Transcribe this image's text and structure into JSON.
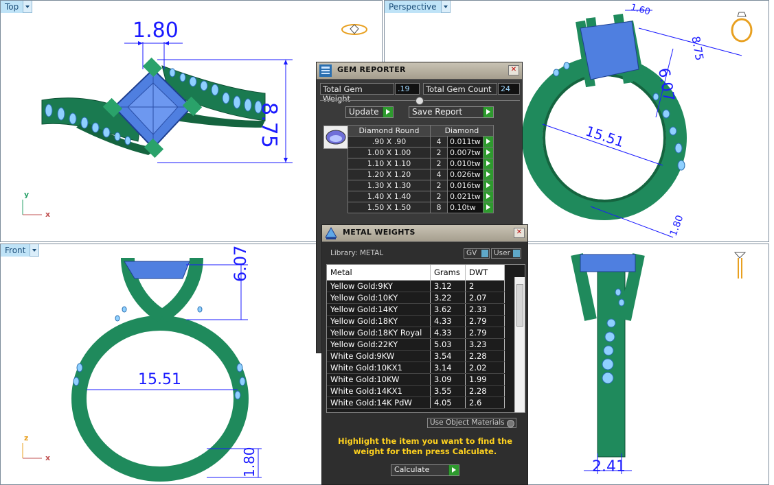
{
  "viewports": {
    "top": {
      "label": "Top"
    },
    "perspective": {
      "label": "Perspective"
    },
    "front": {
      "label": "Front"
    },
    "right": {
      "label": ""
    }
  },
  "axes": {
    "top_y": "y",
    "top_x": "x",
    "front_z": "z",
    "front_x": "x"
  },
  "dimensions": {
    "top_width": "1.80",
    "top_height": "8.75",
    "persp_a": "1.60",
    "persp_b": "8.75",
    "persp_c": "6.07",
    "persp_d": "15.51",
    "persp_e": "1.80",
    "front_height": "6.07",
    "front_diameter": "15.51",
    "front_band": "1.80",
    "right_width": "2.41"
  },
  "gem_reporter": {
    "title": "GEM REPORTER",
    "total_weight_label": "Total Gem Weight",
    "total_weight_value": ".19",
    "total_count_label": "Total Gem Count",
    "total_count_value": "24",
    "update_label": "Update",
    "save_label": "Save Report",
    "col_shape": "Diamond Round",
    "col_material": "Diamond",
    "rows": [
      {
        "size": ".90 X .90",
        "count": "4",
        "weight": "0.011tw"
      },
      {
        "size": "1.00 X 1.00",
        "count": "2",
        "weight": "0.007tw"
      },
      {
        "size": "1.10 X 1.10",
        "count": "2",
        "weight": "0.010tw"
      },
      {
        "size": "1.20 X 1.20",
        "count": "4",
        "weight": "0.026tw"
      },
      {
        "size": "1.30 X 1.30",
        "count": "2",
        "weight": "0.016tw"
      },
      {
        "size": "1.40 X 1.40",
        "count": "2",
        "weight": "0.021tw"
      },
      {
        "size": "1.50 X 1.50",
        "count": "8",
        "weight": "0.10tw"
      }
    ]
  },
  "metal_weights": {
    "title": "METAL WEIGHTS",
    "library_label": "Library: METAL",
    "gv_label": "GV",
    "user_label": "User",
    "col_metal": "Metal",
    "col_grams": "Grams",
    "col_dwt": "DWT",
    "rows": [
      {
        "metal": "Yellow Gold:9KY",
        "grams": "3.12",
        "dwt": "2"
      },
      {
        "metal": "Yellow Gold:10KY",
        "grams": "3.22",
        "dwt": "2.07"
      },
      {
        "metal": "Yellow Gold:14KY",
        "grams": "3.62",
        "dwt": "2.33"
      },
      {
        "metal": "Yellow Gold:18KY",
        "grams": "4.33",
        "dwt": "2.79"
      },
      {
        "metal": "Yellow Gold:18KY Royal",
        "grams": "4.33",
        "dwt": "2.79"
      },
      {
        "metal": "Yellow Gold:22KY",
        "grams": "5.03",
        "dwt": "3.23"
      },
      {
        "metal": "White Gold:9KW",
        "grams": "3.54",
        "dwt": "2.28"
      },
      {
        "metal": "White Gold:10KX1",
        "grams": "3.14",
        "dwt": "2.02"
      },
      {
        "metal": "White Gold:10KW",
        "grams": "3.09",
        "dwt": "1.99"
      },
      {
        "metal": "White Gold:14KX1",
        "grams": "3.55",
        "dwt": "2.28"
      },
      {
        "metal": "White Gold:14K PdW",
        "grams": "4.05",
        "dwt": "2.6"
      }
    ],
    "use_object_label": "Use Object Materials",
    "hint": "Highlight the item you want to find the weight for then press Calculate.",
    "calculate_label": "Calculate"
  },
  "colors": {
    "ring": "#1f8a5c",
    "gem": "#4f7fe0",
    "dim": "#1a1aff",
    "accent": "#ffd21f"
  }
}
